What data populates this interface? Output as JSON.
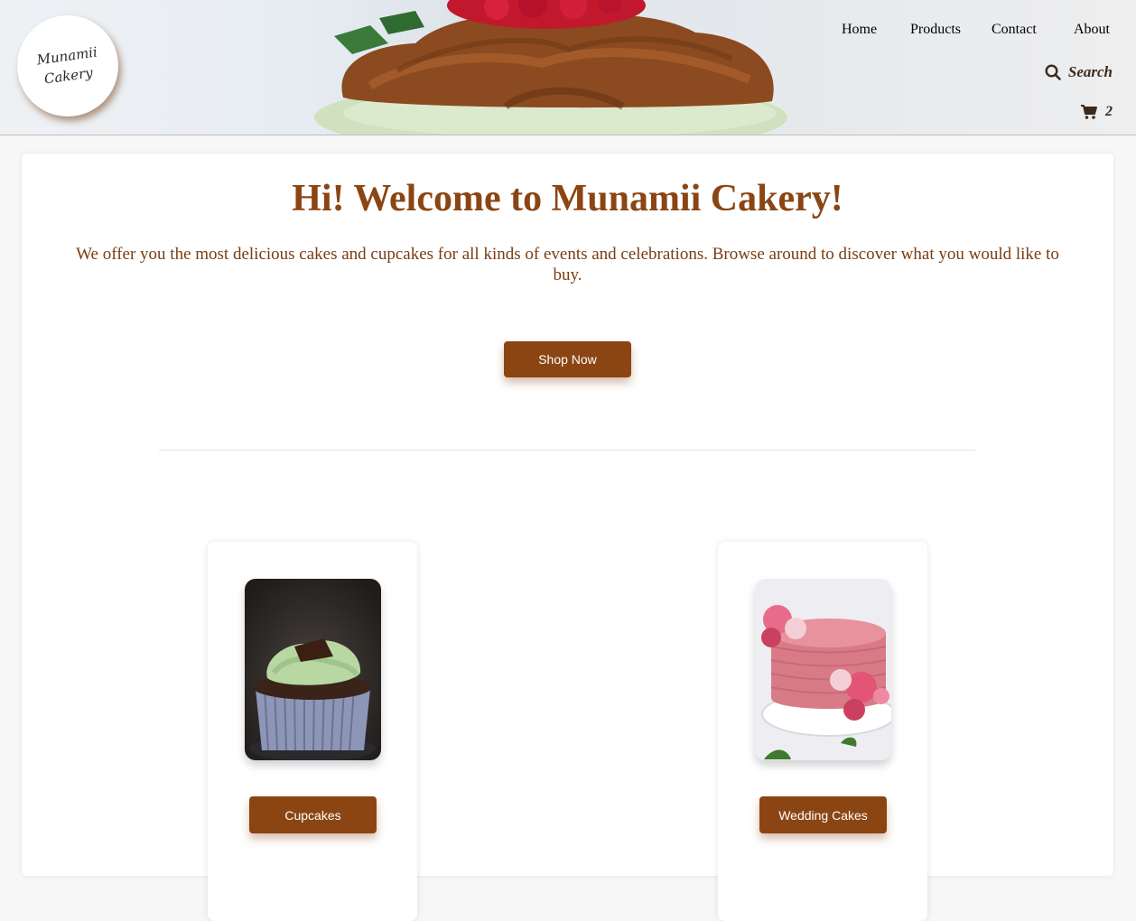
{
  "logo": {
    "line1": "Munamii",
    "line2": "Cakery"
  },
  "nav": {
    "home": "Home",
    "products": "Products",
    "contact": "Contact",
    "about": "About"
  },
  "search": {
    "label": "Search",
    "icon": "search-icon"
  },
  "cart": {
    "count": "2",
    "icon": "cart-icon"
  },
  "hero": {
    "title": "Hi! Welcome to Munamii Cakery!",
    "intro": "We offer you the most delicious cakes and cupcakes for all kinds of events and celebrations. Browse around to discover what you would like to buy.",
    "cta": "Shop Now"
  },
  "categories": [
    {
      "label": "Cupcakes"
    },
    {
      "label": "Wedding Cakes"
    }
  ],
  "colors": {
    "accent": "#8b4513",
    "text": "#3b2a1e"
  }
}
